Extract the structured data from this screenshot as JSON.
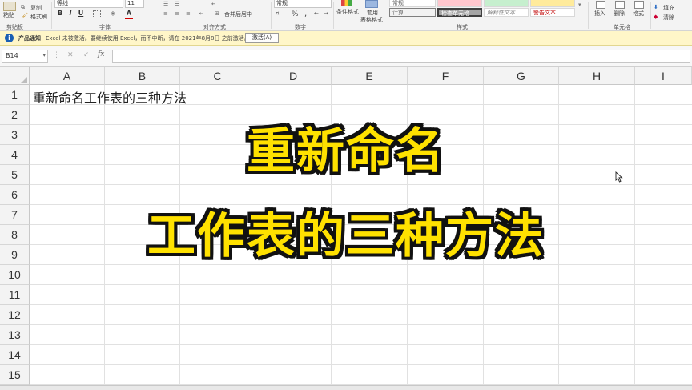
{
  "ribbon": {
    "paste": "粘贴",
    "copy": "复制",
    "format_painter": "格式刷",
    "font_name": "等线",
    "font_size": "11",
    "bold": "B",
    "italic": "I",
    "underline": "U",
    "font_color_letter": "A",
    "merge_center": "合并后居中",
    "percent": "%",
    "comma": ",",
    "number_format": "常规",
    "conditional_format": "条件格式",
    "table_format_line1": "套用",
    "table_format_line2": "表格格式",
    "style_normal": "常规",
    "style_calc": "计算",
    "style_check": "检查单元格",
    "style_explain": "解释性文本",
    "style_warn": "警告文本",
    "insert": "插入",
    "delete": "删除",
    "format": "格式",
    "fill": "填充",
    "clear": "清除",
    "groups": {
      "clipboard": "剪贴板",
      "font": "字体",
      "alignment": "对齐方式",
      "number": "数字",
      "styles": "样式",
      "cells": "单元格"
    }
  },
  "notice": {
    "title": "产品通知",
    "message": "Excel 未被激活。要继续使用 Excel，而不中断，请在 2021年8月8日 之前激活。",
    "button": "激活(A)"
  },
  "formula_bar": {
    "name_box": "B14",
    "cancel": "✕",
    "confirm": "✓",
    "fx": "fx",
    "value": ""
  },
  "sheet": {
    "columns": [
      "A",
      "B",
      "C",
      "D",
      "E",
      "F",
      "G",
      "H",
      "I"
    ],
    "rows": [
      "1",
      "2",
      "3",
      "4",
      "5",
      "6",
      "7",
      "8",
      "9",
      "10",
      "11",
      "12",
      "13",
      "14",
      "15"
    ],
    "cell_A1": "重新命名工作表的三种方法"
  },
  "overlay": {
    "line1": "重新命名",
    "line2": "工作表的三种方法",
    "color": "#ffe100"
  }
}
